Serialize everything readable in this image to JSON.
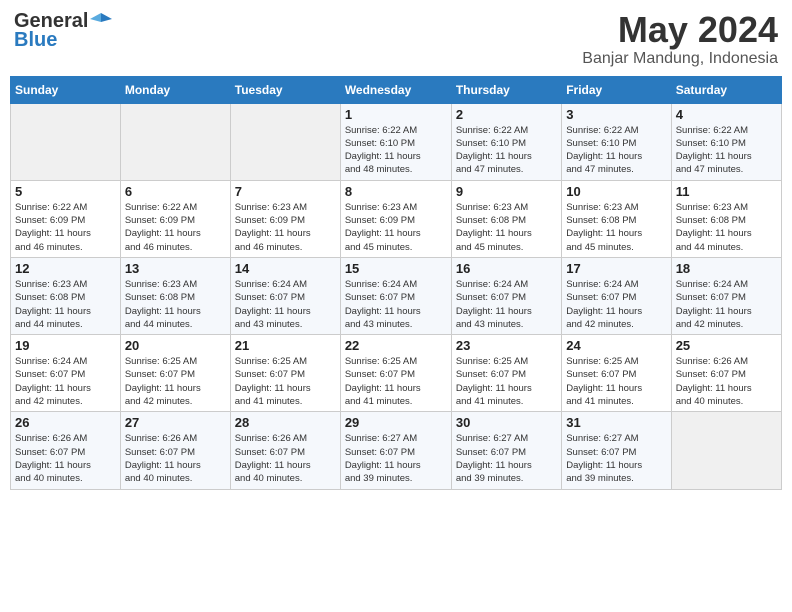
{
  "header": {
    "logo_general": "General",
    "logo_blue": "Blue",
    "month": "May 2024",
    "location": "Banjar Mandung, Indonesia"
  },
  "weekdays": [
    "Sunday",
    "Monday",
    "Tuesday",
    "Wednesday",
    "Thursday",
    "Friday",
    "Saturday"
  ],
  "weeks": [
    [
      {
        "day": "",
        "info": ""
      },
      {
        "day": "",
        "info": ""
      },
      {
        "day": "",
        "info": ""
      },
      {
        "day": "1",
        "info": "Sunrise: 6:22 AM\nSunset: 6:10 PM\nDaylight: 11 hours\nand 48 minutes."
      },
      {
        "day": "2",
        "info": "Sunrise: 6:22 AM\nSunset: 6:10 PM\nDaylight: 11 hours\nand 47 minutes."
      },
      {
        "day": "3",
        "info": "Sunrise: 6:22 AM\nSunset: 6:10 PM\nDaylight: 11 hours\nand 47 minutes."
      },
      {
        "day": "4",
        "info": "Sunrise: 6:22 AM\nSunset: 6:10 PM\nDaylight: 11 hours\nand 47 minutes."
      }
    ],
    [
      {
        "day": "5",
        "info": "Sunrise: 6:22 AM\nSunset: 6:09 PM\nDaylight: 11 hours\nand 46 minutes."
      },
      {
        "day": "6",
        "info": "Sunrise: 6:22 AM\nSunset: 6:09 PM\nDaylight: 11 hours\nand 46 minutes."
      },
      {
        "day": "7",
        "info": "Sunrise: 6:23 AM\nSunset: 6:09 PM\nDaylight: 11 hours\nand 46 minutes."
      },
      {
        "day": "8",
        "info": "Sunrise: 6:23 AM\nSunset: 6:09 PM\nDaylight: 11 hours\nand 45 minutes."
      },
      {
        "day": "9",
        "info": "Sunrise: 6:23 AM\nSunset: 6:08 PM\nDaylight: 11 hours\nand 45 minutes."
      },
      {
        "day": "10",
        "info": "Sunrise: 6:23 AM\nSunset: 6:08 PM\nDaylight: 11 hours\nand 45 minutes."
      },
      {
        "day": "11",
        "info": "Sunrise: 6:23 AM\nSunset: 6:08 PM\nDaylight: 11 hours\nand 44 minutes."
      }
    ],
    [
      {
        "day": "12",
        "info": "Sunrise: 6:23 AM\nSunset: 6:08 PM\nDaylight: 11 hours\nand 44 minutes."
      },
      {
        "day": "13",
        "info": "Sunrise: 6:23 AM\nSunset: 6:08 PM\nDaylight: 11 hours\nand 44 minutes."
      },
      {
        "day": "14",
        "info": "Sunrise: 6:24 AM\nSunset: 6:07 PM\nDaylight: 11 hours\nand 43 minutes."
      },
      {
        "day": "15",
        "info": "Sunrise: 6:24 AM\nSunset: 6:07 PM\nDaylight: 11 hours\nand 43 minutes."
      },
      {
        "day": "16",
        "info": "Sunrise: 6:24 AM\nSunset: 6:07 PM\nDaylight: 11 hours\nand 43 minutes."
      },
      {
        "day": "17",
        "info": "Sunrise: 6:24 AM\nSunset: 6:07 PM\nDaylight: 11 hours\nand 42 minutes."
      },
      {
        "day": "18",
        "info": "Sunrise: 6:24 AM\nSunset: 6:07 PM\nDaylight: 11 hours\nand 42 minutes."
      }
    ],
    [
      {
        "day": "19",
        "info": "Sunrise: 6:24 AM\nSunset: 6:07 PM\nDaylight: 11 hours\nand 42 minutes."
      },
      {
        "day": "20",
        "info": "Sunrise: 6:25 AM\nSunset: 6:07 PM\nDaylight: 11 hours\nand 42 minutes."
      },
      {
        "day": "21",
        "info": "Sunrise: 6:25 AM\nSunset: 6:07 PM\nDaylight: 11 hours\nand 41 minutes."
      },
      {
        "day": "22",
        "info": "Sunrise: 6:25 AM\nSunset: 6:07 PM\nDaylight: 11 hours\nand 41 minutes."
      },
      {
        "day": "23",
        "info": "Sunrise: 6:25 AM\nSunset: 6:07 PM\nDaylight: 11 hours\nand 41 minutes."
      },
      {
        "day": "24",
        "info": "Sunrise: 6:25 AM\nSunset: 6:07 PM\nDaylight: 11 hours\nand 41 minutes."
      },
      {
        "day": "25",
        "info": "Sunrise: 6:26 AM\nSunset: 6:07 PM\nDaylight: 11 hours\nand 40 minutes."
      }
    ],
    [
      {
        "day": "26",
        "info": "Sunrise: 6:26 AM\nSunset: 6:07 PM\nDaylight: 11 hours\nand 40 minutes."
      },
      {
        "day": "27",
        "info": "Sunrise: 6:26 AM\nSunset: 6:07 PM\nDaylight: 11 hours\nand 40 minutes."
      },
      {
        "day": "28",
        "info": "Sunrise: 6:26 AM\nSunset: 6:07 PM\nDaylight: 11 hours\nand 40 minutes."
      },
      {
        "day": "29",
        "info": "Sunrise: 6:27 AM\nSunset: 6:07 PM\nDaylight: 11 hours\nand 39 minutes."
      },
      {
        "day": "30",
        "info": "Sunrise: 6:27 AM\nSunset: 6:07 PM\nDaylight: 11 hours\nand 39 minutes."
      },
      {
        "day": "31",
        "info": "Sunrise: 6:27 AM\nSunset: 6:07 PM\nDaylight: 11 hours\nand 39 minutes."
      },
      {
        "day": "",
        "info": ""
      }
    ]
  ]
}
